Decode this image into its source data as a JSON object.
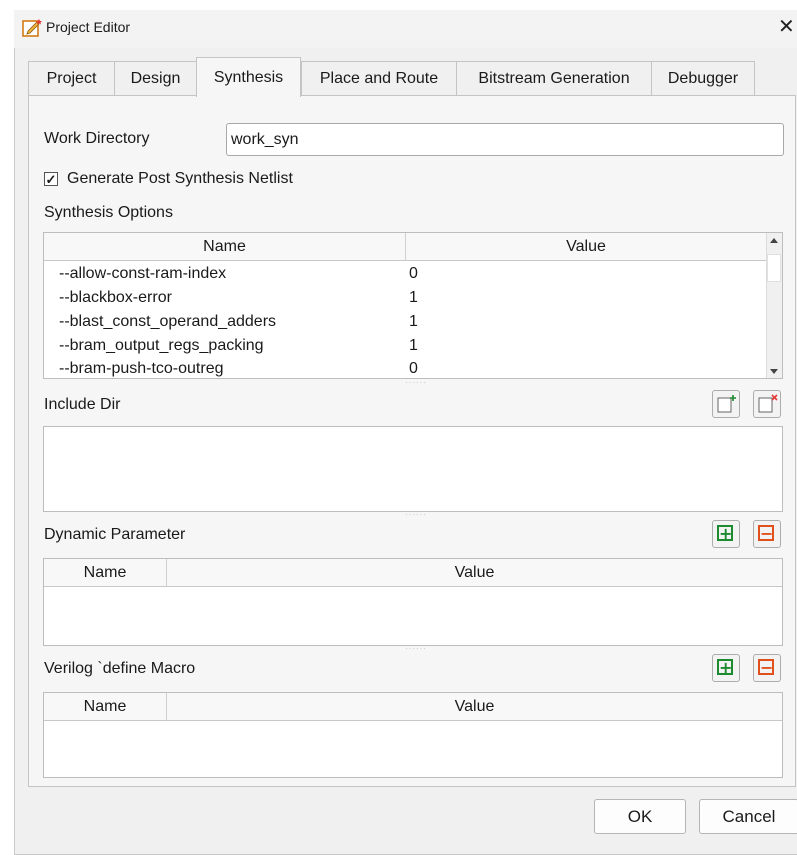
{
  "window": {
    "title": "Project Editor",
    "close_glyph": "✕"
  },
  "tabs": [
    {
      "label": "Project",
      "active": false
    },
    {
      "label": "Design",
      "active": false
    },
    {
      "label": "Synthesis",
      "active": true
    },
    {
      "label": "Place and Route",
      "active": false
    },
    {
      "label": "Bitstream Generation",
      "active": false
    },
    {
      "label": "Debugger",
      "active": false
    }
  ],
  "work_directory": {
    "label": "Work Directory",
    "value": "work_syn"
  },
  "post_synth": {
    "label": "Generate Post Synthesis Netlist",
    "checked": true,
    "check_glyph": "✓"
  },
  "synthesis_options": {
    "label": "Synthesis Options",
    "columns": [
      "Name",
      "Value"
    ],
    "rows": [
      {
        "name": "--allow-const-ram-index",
        "value": "0"
      },
      {
        "name": "--blackbox-error",
        "value": "1"
      },
      {
        "name": "--blast_const_operand_adders",
        "value": "1"
      },
      {
        "name": "--bram_output_regs_packing",
        "value": "1"
      },
      {
        "name": "--bram-push-tco-outreg",
        "value": "0"
      }
    ]
  },
  "include_dir": {
    "label": "Include Dir",
    "add_icon": "add-file-icon",
    "remove_icon": "remove-file-icon"
  },
  "dynamic_parameter": {
    "label": "Dynamic Parameter",
    "columns": [
      "Name",
      "Value"
    ],
    "add_glyph": "+",
    "remove_glyph": "−"
  },
  "verilog_define": {
    "label": "Verilog `define Macro",
    "columns": [
      "Name",
      "Value"
    ],
    "add_glyph": "+",
    "remove_glyph": "−"
  },
  "buttons": {
    "ok": "OK",
    "cancel": "Cancel"
  },
  "colors": {
    "add_green": "#1c8a2e",
    "remove_red": "#e0501c",
    "icon_red": "#e53935"
  }
}
